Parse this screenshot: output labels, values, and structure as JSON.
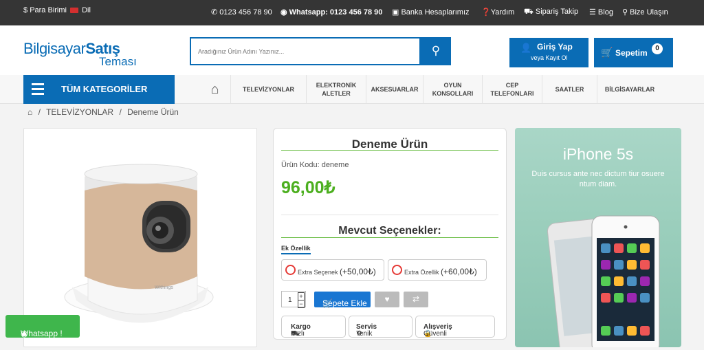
{
  "topbar": {
    "currency": "Para Birimi",
    "language": "Dil",
    "phone": "0123 456 78 90",
    "whatsapp": "Whatsapp: 0123 456 78 90",
    "bank": "Banka Hesaplarımız",
    "help": "Yardım",
    "tracking": "Sipariş Takip",
    "blog": "Blog",
    "contact": "Bize Ulaşın"
  },
  "logo": {
    "part1": "Bilgisayar",
    "part2": "Satış",
    "part3": "Teması"
  },
  "search": {
    "placeholder": "Aradığınız Ürün Adını Yazınız..."
  },
  "login": {
    "title": "Giriş Yap",
    "subtitle": "veya Kayıt Ol"
  },
  "cart": {
    "label": "Sepetim",
    "count": "0"
  },
  "nav": {
    "all_categories": "TÜM KATEGORİLER",
    "items": [
      {
        "label": "TELEVİZYONLAR"
      },
      {
        "label": "ELEKTRONİK ALETLER"
      },
      {
        "label": "AKSESUARLAR"
      },
      {
        "label": "OYUN KONSOLLARI"
      },
      {
        "label": "CEP TELEFONLARI"
      },
      {
        "label": "SAATLER"
      },
      {
        "label": "BİLGİSAYARLAR"
      }
    ]
  },
  "breadcrumb": {
    "sep": "/",
    "category": "TELEVİZYONLAR",
    "product": "Deneme Ürün"
  },
  "product": {
    "name": "Deneme Ürün",
    "code": "Ürün Kodu: deneme",
    "price": "96,00₺",
    "options_title": "Mevcut Seçenekler:",
    "extra_feature": "Ek Özellik",
    "options": [
      {
        "label": "Extra Seçenek",
        "price": "(+50,00₺)"
      },
      {
        "label": "Extra Özellik",
        "price": "(+60,00₺)"
      }
    ],
    "quantity": "1",
    "add_to_cart": "Sepete Ekle",
    "brand_mark": "Withings",
    "features": [
      {
        "light": "Hızlı",
        "bold": "Kargo"
      },
      {
        "light": "Tenik",
        "bold": "Servis"
      },
      {
        "light": "Güvenli",
        "bold": "Alışveriş"
      }
    ]
  },
  "banner": {
    "title": "iPhone 5s",
    "subtitle": "Duis cursus ante nec dictum tiur osuere ntum diam."
  },
  "whatsapp_button": "Whatsapp !",
  "colors": {
    "brand": "#0a6cb5",
    "price": "#4caf1f",
    "whatsapp": "#3fb64c",
    "topbar": "#353535"
  }
}
